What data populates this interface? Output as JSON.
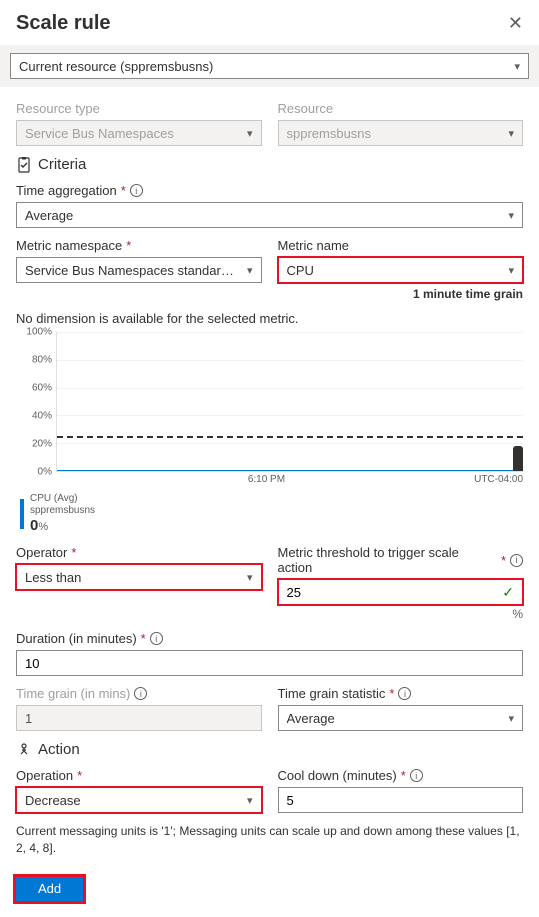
{
  "header": {
    "title": "Scale rule"
  },
  "resourceSelect": {
    "value": "Current resource (sppremsbusns)"
  },
  "resourceType": {
    "label": "Resource type",
    "value": "Service Bus Namespaces"
  },
  "resource": {
    "label": "Resource",
    "value": "sppremsbusns"
  },
  "criteria": {
    "heading": "Criteria"
  },
  "timeAgg": {
    "label": "Time aggregation",
    "value": "Average"
  },
  "metricNs": {
    "label": "Metric namespace",
    "value": "Service Bus Namespaces standard me..."
  },
  "metricName": {
    "label": "Metric name",
    "value": "CPU",
    "grainNote": "1 minute time grain"
  },
  "noDim": "No dimension is available for the selected metric.",
  "chart_data": {
    "type": "line",
    "series": [
      {
        "name": "CPU (Avg)",
        "resource": "sppremsbusns",
        "current_value": 0,
        "unit": "%",
        "approx_flat_value": 0
      }
    ],
    "threshold_line": 25,
    "y_ticks": [
      "0%",
      "20%",
      "40%",
      "60%",
      "80%",
      "100%"
    ],
    "ylim": [
      0,
      100
    ],
    "x_center_label": "6:10 PM",
    "tz_label": "UTC-04:00",
    "legend": {
      "title": "CPU (Avg)",
      "sub": "sppremsbusns",
      "value": "0",
      "unit": "%"
    }
  },
  "operator": {
    "label": "Operator",
    "value": "Less than"
  },
  "threshold": {
    "label": "Metric threshold to trigger scale action",
    "value": "25",
    "unit": "%"
  },
  "duration": {
    "label": "Duration (in minutes)",
    "value": "10"
  },
  "timeGrain": {
    "label": "Time grain (in mins)",
    "value": "1"
  },
  "timeGrainStat": {
    "label": "Time grain statistic",
    "value": "Average"
  },
  "action": {
    "heading": "Action"
  },
  "operation": {
    "label": "Operation",
    "value": "Decrease"
  },
  "cooldown": {
    "label": "Cool down (minutes)",
    "value": "5"
  },
  "unitsNote": "Current messaging units is '1'; Messaging units can scale up and down among these values [1, 2, 4, 8].",
  "addBtn": "Add"
}
